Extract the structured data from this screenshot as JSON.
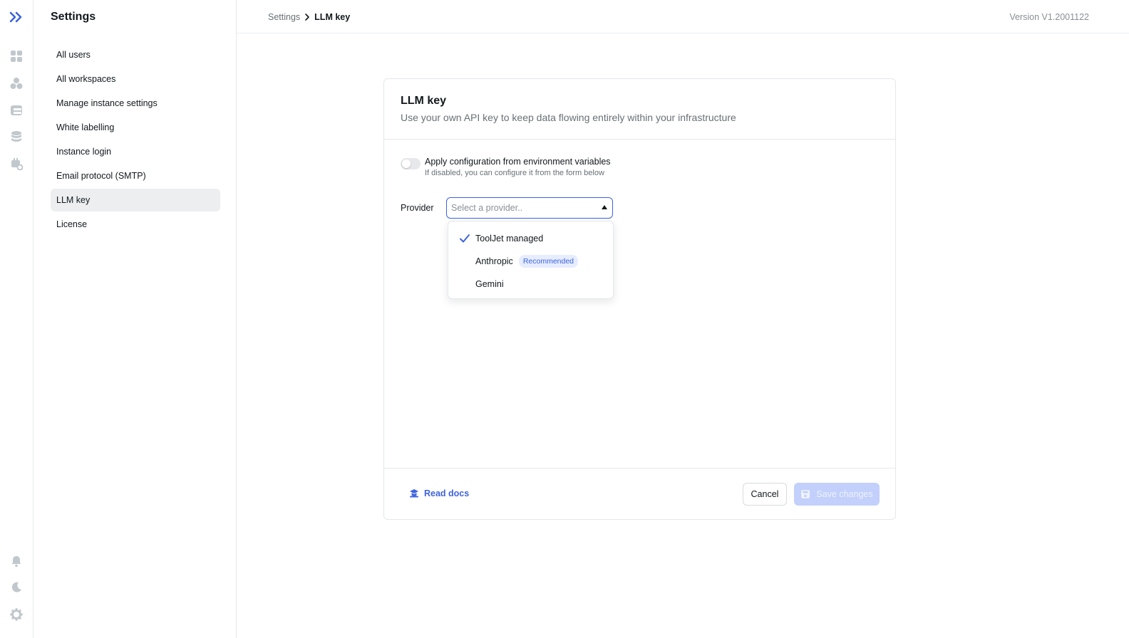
{
  "rail": {
    "icons": [
      "logo-icon",
      "apps-icon",
      "workspace-icon",
      "table-icon",
      "database-icon",
      "plugins-icon",
      "bell-icon",
      "moon-icon",
      "gear-icon"
    ]
  },
  "sidebar": {
    "title": "Settings",
    "items": [
      {
        "label": "All users",
        "active": false
      },
      {
        "label": "All workspaces",
        "active": false
      },
      {
        "label": "Manage instance settings",
        "active": false
      },
      {
        "label": "White labelling",
        "active": false
      },
      {
        "label": "Instance login",
        "active": false
      },
      {
        "label": "Email protocol (SMTP)",
        "active": false
      },
      {
        "label": "LLM key",
        "active": true
      },
      {
        "label": "License",
        "active": false
      }
    ]
  },
  "topbar": {
    "breadcrumb": [
      "Settings",
      "LLM key"
    ],
    "version": "Version V1.2001122"
  },
  "card": {
    "title": "LLM key",
    "subtitle": "Use your own API key to keep data flowing entirely within your infrastructure",
    "toggle": {
      "label": "Apply configuration from environment variables",
      "hint": "If disabled, you can configure it from the form below",
      "on": false
    },
    "provider": {
      "label": "Provider",
      "placeholder": "Select a provider..",
      "options": [
        {
          "label": "ToolJet managed",
          "selected": true,
          "badge": ""
        },
        {
          "label": "Anthropic",
          "selected": false,
          "badge": "Recommended"
        },
        {
          "label": "Gemini",
          "selected": false,
          "badge": ""
        }
      ]
    },
    "footer": {
      "docs_label": "Read docs",
      "cancel_label": "Cancel",
      "save_label": "Save changes"
    }
  },
  "colors": {
    "accent": "#3e63dd",
    "save_disabled_bg": "#c2d0fb",
    "active_nav_bg": "#eceef0"
  }
}
